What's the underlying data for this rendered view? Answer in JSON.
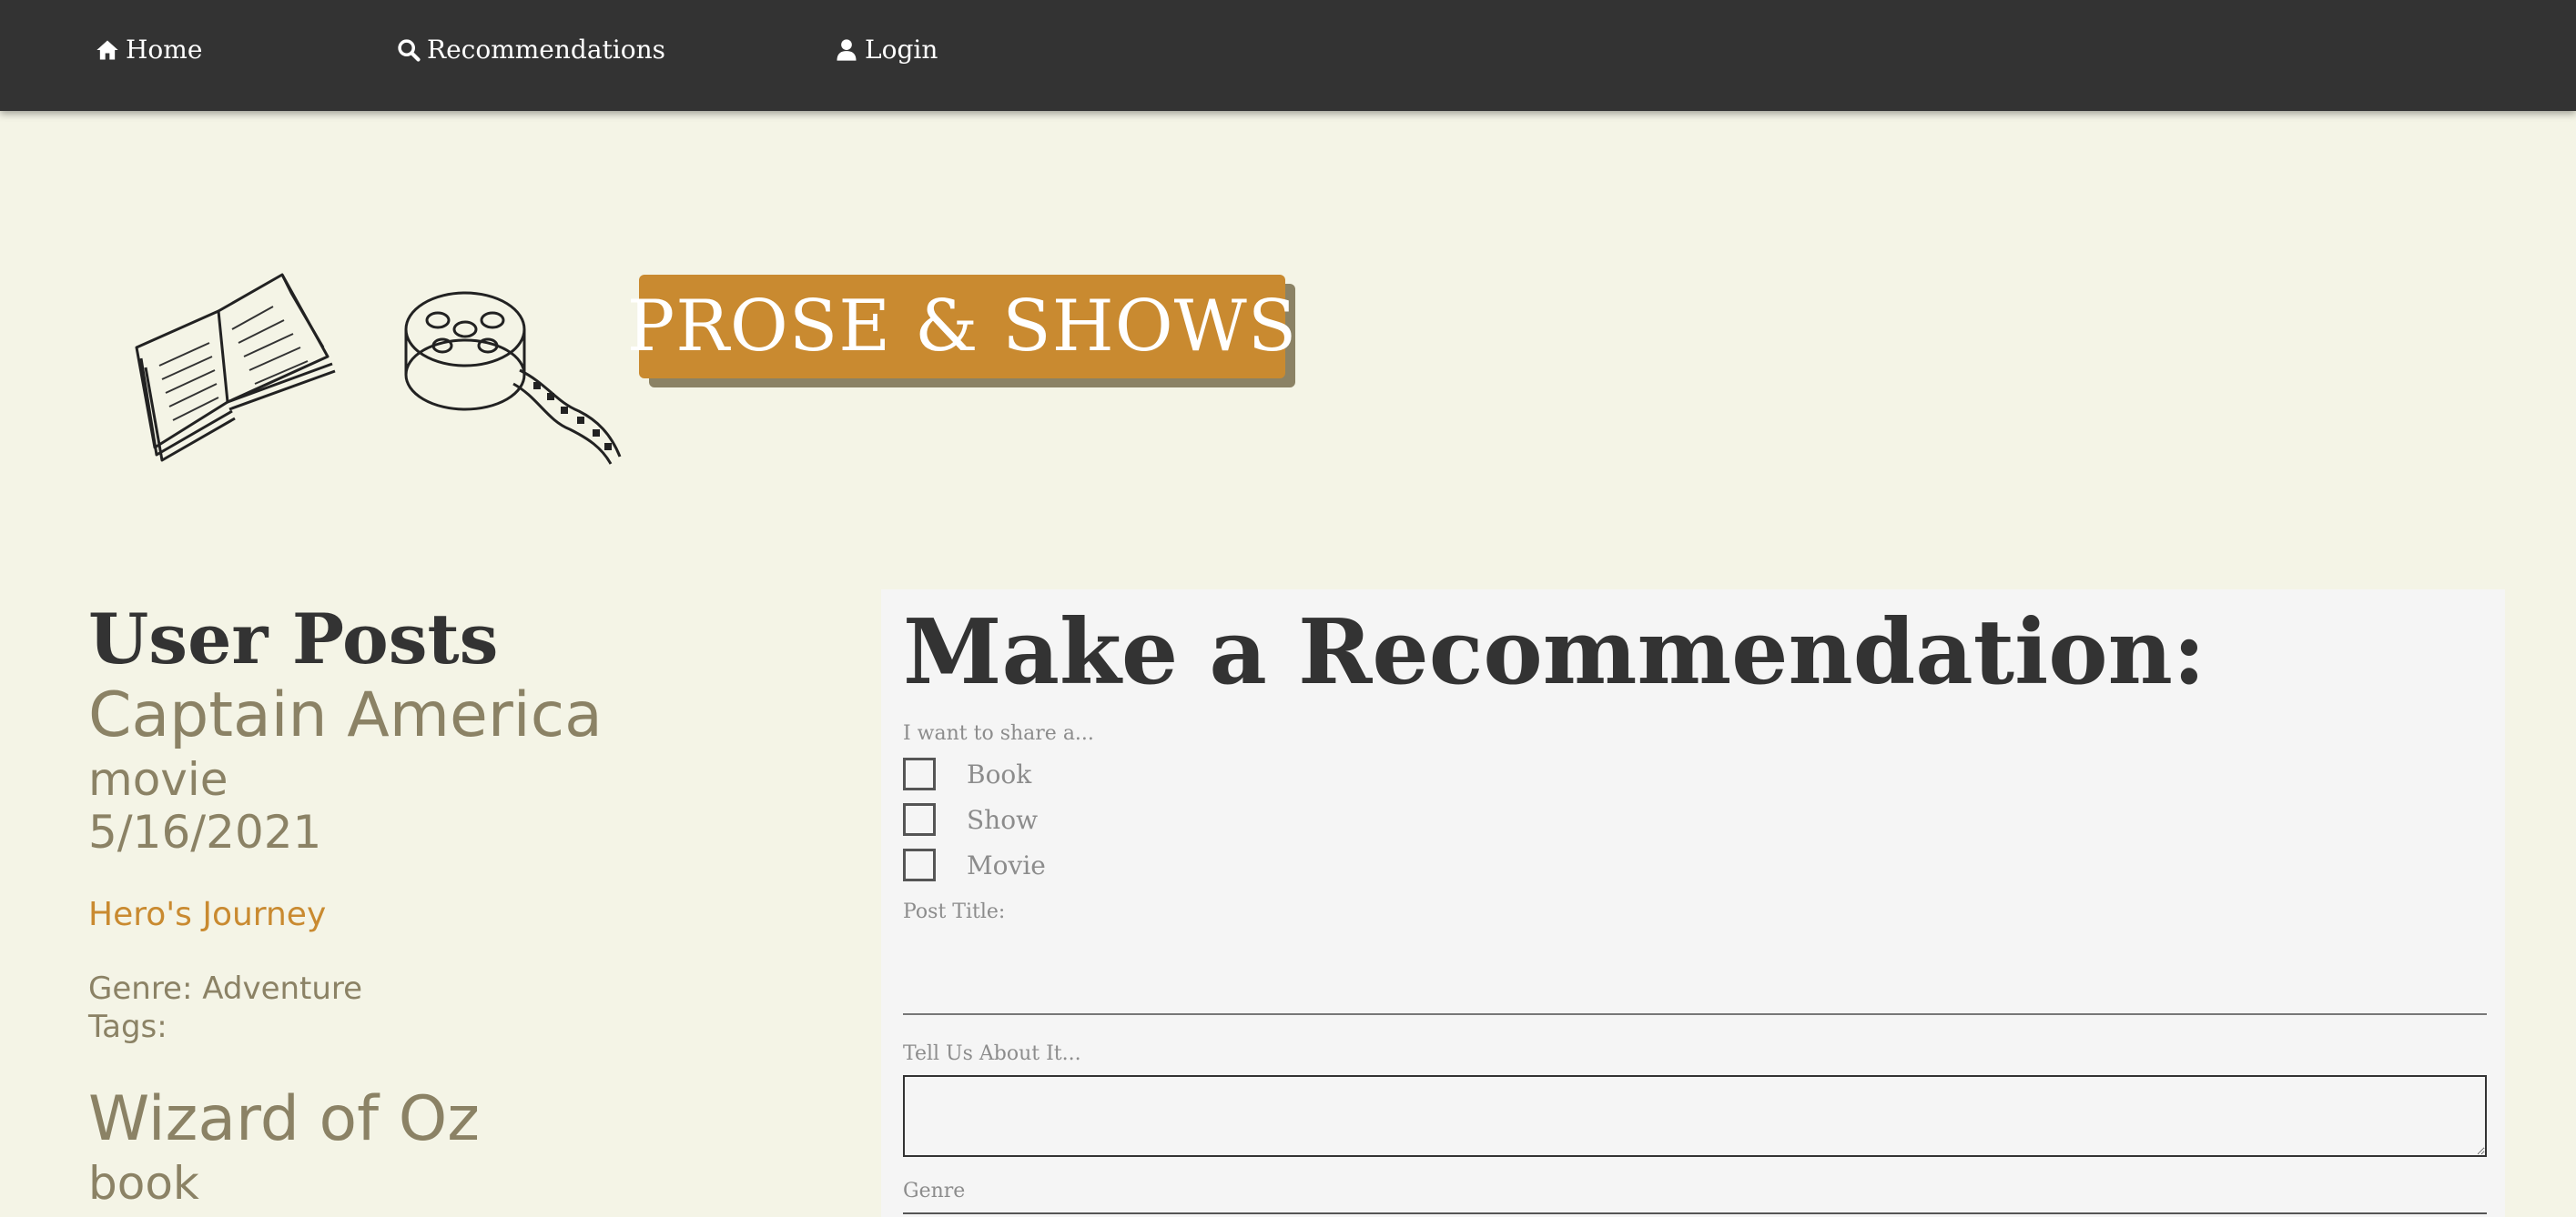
{
  "nav": {
    "home": "Home",
    "recommendations": "Recommendations",
    "login": "Login"
  },
  "logo": {
    "text": "PROSE & SHOWS",
    "color": "#c98a30",
    "shadow_color": "#8b8265"
  },
  "posts": {
    "heading": "User Posts",
    "items": [
      {
        "title": "Captain America",
        "type": "movie",
        "date": "5/16/2021",
        "headline": "Hero's Journey",
        "genre": "Genre: Adventure",
        "tags": "Tags:"
      },
      {
        "title": "Wizard of Oz",
        "type": "book"
      }
    ]
  },
  "form": {
    "heading": "Make a Recommendation:",
    "share_label": "I want to share a...",
    "options": [
      "Book",
      "Show",
      "Movie"
    ],
    "post_title_label": "Post Title:",
    "post_title_value": "",
    "about_label": "Tell Us About It...",
    "about_value": "",
    "genre_label": "Genre"
  },
  "colors": {
    "navbar": "#333333",
    "background": "#f4f4e6",
    "accent": "#c98a30",
    "muted": "#8b8265"
  }
}
